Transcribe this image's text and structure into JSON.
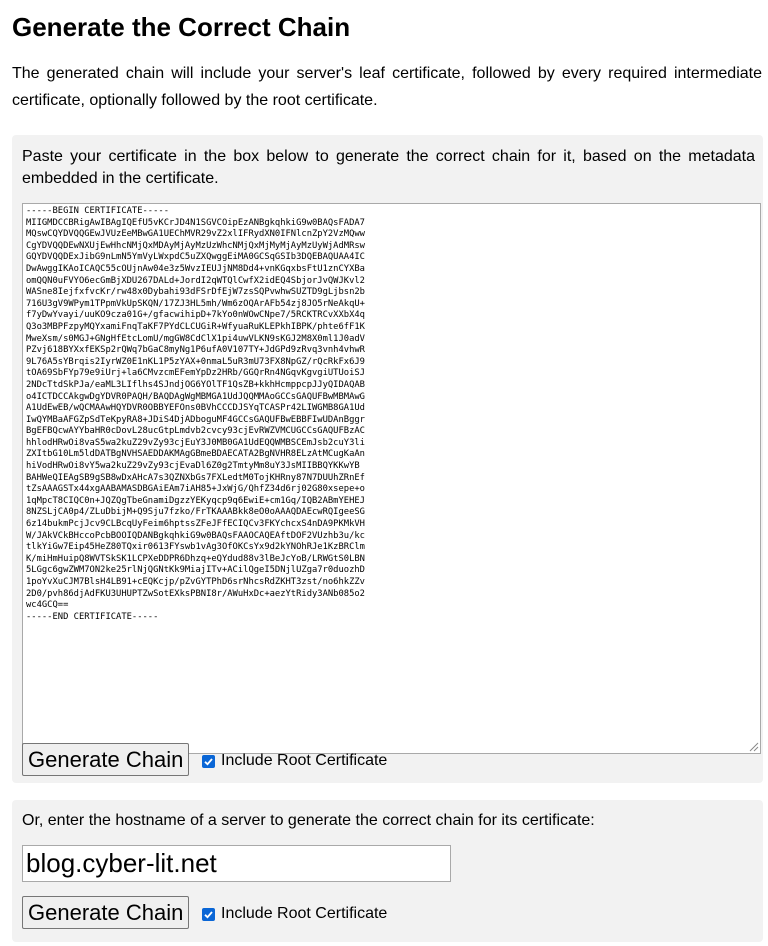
{
  "page": {
    "title": "Generate the Correct Chain",
    "intro": "The generated chain will include your server's leaf certificate, followed by every required intermediate certificate, optionally followed by the root certificate."
  },
  "paste_section": {
    "instructions": "Paste your certificate in the box below to generate the correct chain for it, based on the metadata embedded in the certificate.",
    "certificate_text": "-----BEGIN CERTIFICATE-----\nMIIGMDCCBRigAwIBAgIQEfU5vKCrJD4N1SGVCOipEzANBgkqhkiG9w0BAQsFADA7\nMQswCQYDVQQGEwJVUzEeMBwGA1UEChMVR29vZ2xlIFRydXN0IFNlcnZpY2VzMQww\nCgYDVQQDEwNXUjEwHhcNMjQxMDAyMjAyMzUzWhcNMjQxMjMyMjAyMzUyWjAdMRsw\nGQYDVQQDExJibG9nLmN5YmVyLWxpdC5uZXQwggEiMA0GCSqGSIb3DQEBAQUAA4IC\nDwAwggIKAoICAQC55cOUjnAw04e3z5WvzIEUJjNM8Dd4+vnKGqxbsFtU1znCYXBa\nomQQN0uFVYO6ecGmBjXDU267DALd+JordI2qWTQlCwfX2idEQ4SbjorJvQWJKvl2\nWASne8IejfxfvcKr/rw48x0Dybahi93dFSrDfEjW7zsSQPvwhwSUZTD9gLjbsn2b\n716U3gV9WPym1TPpmVkUpSKQN/17ZJ3HL5mh/Wm6zOQArAFb54zj8JO5rNeAkqU+\nf7yDwYvayi/uuKO9cza01G+/gfacwihipD+7kYo0nWOwCNpe7/5RCKTRCvXXbX4q\nQ3o3MBPFzpyMQYxamiFnqTaKF7PYdCLCUGiR+WfyuaRuKLEPkhIBPK/phte6fF1K\nMweXsm/s0MGJ+GNgHfEtcLomU/mgGW8CdClX1pi4uwVLKN9sKGJ2M8X0ml1J0adV\nPZvj618BYXxfEKSp2rQWq7bGaC8myNg1P6ufA0V107TY+JdGPd9zRvq3vnh4vhwR\n9L76A5sYBrqis2IyrWZ0E1nKL1P5zYAX+0nmaL5uR3mU73FX8NpGZ/rQcRkFx6J9\ntOA69SbFYp79e9iUrj+la6CMvzcmEFemYpDz2HRb/GGQrRn4NGqvKgvgiUTUoiSJ\n2NDcTtdSkPJa/eaML3LIflhs4SJndjOG6YOlTF1QsZB+kkhHcmppcpJJyQIDAQAB\no4ICTDCCAkgwDgYDVR0PAQH/BAQDAgWgMBMGA1UdJQQMMAoGCCsGAQUFBwMBMAwG\nA1UdEwEB/wQCMAAwHQYDVR0OBBYEFOns0BVhCCCDJSYqTCASPr42LIWGMB8GA1Ud\nIwQYMBaAFGZpSdTeKpyRA8+JDiS4DjADboguMF4GCCsGAQUFBwEBBFIwUDAnBggr\nBgEFBQcwAYYbaHR0cDovL28ucGtpLmdvb2cvcy93cjEvRWZVMCUGCCsGAQUFBzAC\nhhlodHRwOi8vaS5wa2kuZ29vZy93cjEuY3J0MB0GA1UdEQQWMBSCEmJsb2cuY3li\nZXItbG10Lm5ldDATBgNVHSAEDDAKMAgGBmeBDAECATA2BgNVHR8ELzAtMCugKaAn\nhiVodHRwOi8vY5wa2kuZ29vZy93cjEvaDl6Z0g2TmtyMm8uY3JsMIIBBQYKKwYB\nBAHWeQIEAgSB9gSB8wDxAHcA7s3QZNXbGs7FXLedtM0TojKHRny87N7DUUhZRnEf\ntZsAAAGSTx44xgAABAMASDBGAiEAm7iAH85+JxWjG/QhfZ34d6rj02G80xsepe+o\n1qMpcT8CIQC0n+JQZQgTbeGnamiDgzzYEKyqcp9q6EwiE+cm1Gq/IQB2ABmYEHEJ\n8NZSLjCA0p4/ZLuDbijM+Q9Sju7fzko/FrTKAAABkk8eO0oAAAQDAEcwRQIgeeSG\n6z14bukmPcjJcv9CLBcqUyFeim6hptssZFeJFfECIQCv3FKYchcxS4nDA9PKMkVH\nW/JAkVCkBHccoPcbBOOIQDANBgkqhkiG9w0BAQsFAAOCAQEAftDOF2VUzhb3u/kc\ntlkYiGw7Eip45HeZ80TQxir0613FYswb1vAg3OfOKCsYx9d2kYNOhRJe1KzBRClm\nK/miHmHuipQ8WVTSkSK1LCPXeDDPR6Dhzq+eQYdud88v3lBeJcYoB/LRWGtS0LBN\n5LGgc6gwZWM7ON2ke25rlNjQGNtKk9MiajITv+ACilQgeI5DNjlUZga7r0duozhD\n1poYvXuCJM7BlsH4LB91+cEQKcjp/pZvGYTPhD6srNhcsRdZKHT3zst/no6hkZZv\n2D0/pvh86djAdFKU3UHUPTZwSotEXksPBNI8r/AWuHxDc+aezYtRidy3ANb085o2\nwc4GCQ==\n-----END CERTIFICATE-----",
    "button_label": "Generate Chain",
    "checkbox_label": "Include Root Certificate",
    "checkbox_checked": true
  },
  "hostname_section": {
    "instructions": "Or, enter the hostname of a server to generate the correct chain for its certificate:",
    "hostname_value": "blog.cyber-lit.net",
    "button_label": "Generate Chain",
    "checkbox_label": "Include Root Certificate",
    "checkbox_checked": true
  },
  "colors": {
    "panel_background": "#f2f2f2",
    "checkbox_accent": "#0a66d6",
    "button_background": "#efefef"
  }
}
